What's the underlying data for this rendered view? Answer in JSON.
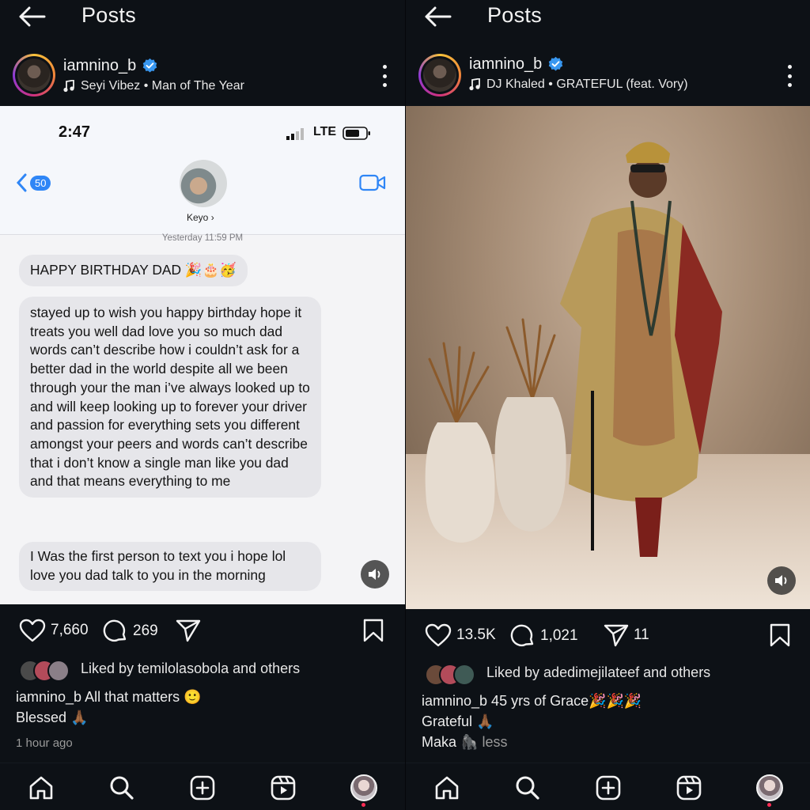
{
  "colors": {
    "background": "#0d1116",
    "verified": "#3897f0",
    "chat_accent": "#2f86f6",
    "notification_dot": "#ff2d55"
  },
  "left": {
    "page_title": "Posts",
    "username": "iamnino_b",
    "music": "Seyi Vibez • Man of The Year",
    "chat": {
      "time": "2:47",
      "network": "LTE",
      "back_count": "50",
      "contact": "Keyo",
      "timestamp": "Yesterday 11:59 PM",
      "msg1": "HAPPY BIRTHDAY DAD 🎉🎂🥳",
      "msg2": "stayed up to wish you happy birthday hope it treats you well dad love you so much dad words can’t describe how i couldn’t ask for a better dad in the world despite all we been through your the man i’ve always looked up to and will keep looking up to forever your driver and passion for everything sets you different amongst your peers and words can’t describe that i don’t know a single man like you dad and that means everything to me",
      "msg3": "I Was the first person to text you i hope lol love you dad talk to you in the morning"
    },
    "likes": "7,660",
    "comments": "269",
    "liked_by": "Liked by temilolasobola and others",
    "caption_line1": "iamnino_b All that matters 🙂",
    "caption_line2": "Blessed 🙏🏾",
    "time_ago": "1 hour ago"
  },
  "right": {
    "page_title": "Posts",
    "username": "iamnino_b",
    "music": "DJ Khaled • GRATEFUL (feat. Vory)",
    "likes": "13.5K",
    "comments": "1,021",
    "shares": "11",
    "liked_by": "Liked by adedimejilateef and others",
    "caption_line1": "iamnino_b 45 yrs of Grace🎉🎉🎉",
    "caption_line2": "Grateful 🙏🏾",
    "caption_line3": "Maka 🦍",
    "less": "less"
  }
}
